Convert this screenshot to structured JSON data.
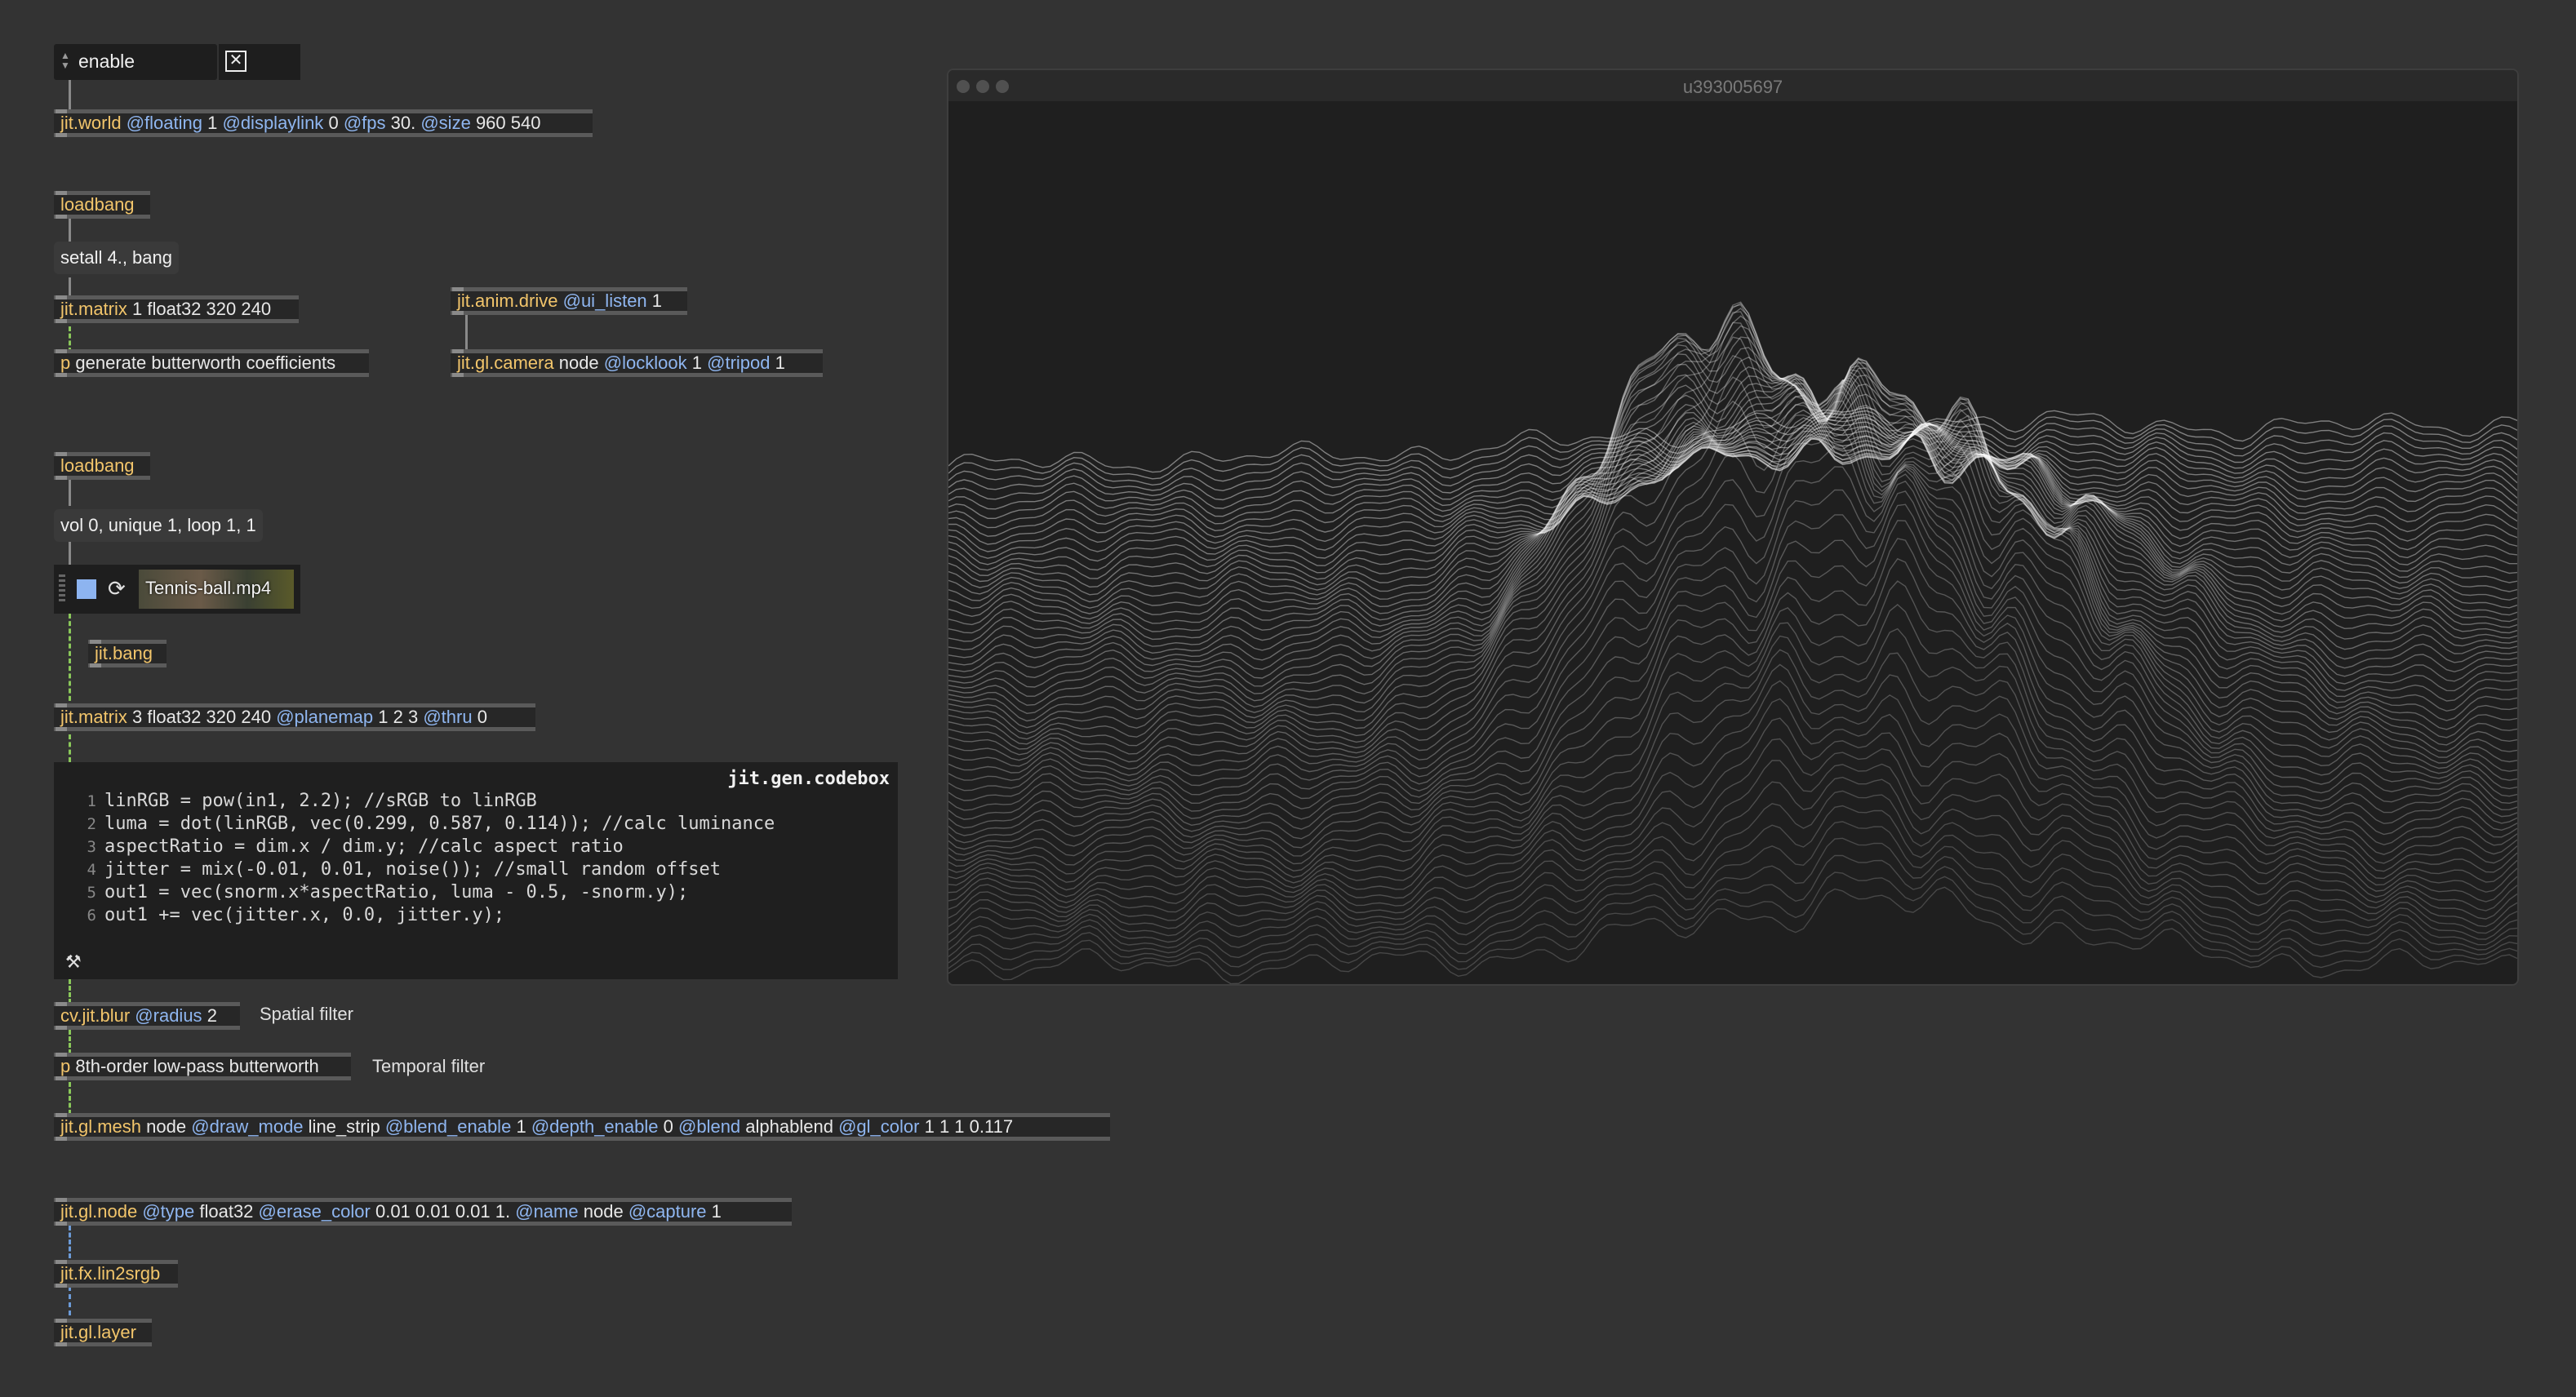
{
  "umenu": {
    "selected": "enable"
  },
  "toggle": {
    "checked": true,
    "glyph": "✕"
  },
  "objects": {
    "jit_world": {
      "cls": "jit.world",
      "parts": [
        [
          "attr",
          "@floating"
        ],
        [
          "arg",
          "1"
        ],
        [
          "attr",
          "@displaylink"
        ],
        [
          "arg",
          "0"
        ],
        [
          "attr",
          "@fps"
        ],
        [
          "arg",
          "30."
        ],
        [
          "attr",
          "@size"
        ],
        [
          "arg",
          "960 540"
        ]
      ]
    },
    "loadbang1": {
      "cls": "loadbang",
      "parts": []
    },
    "jit_matrix1": {
      "cls": "jit.matrix",
      "parts": [
        [
          "arg",
          "1 float32 320 240"
        ]
      ]
    },
    "p_butter_coef": {
      "cls": "p",
      "parts": [
        [
          "arg",
          "generate butterworth coefficients"
        ]
      ]
    },
    "jit_anim_drive": {
      "cls": "jit.anim.drive",
      "parts": [
        [
          "attr",
          "@ui_listen"
        ],
        [
          "arg",
          "1"
        ]
      ]
    },
    "jit_gl_camera": {
      "cls": "jit.gl.camera",
      "parts": [
        [
          "arg",
          "node"
        ],
        [
          "attr",
          "@locklook"
        ],
        [
          "arg",
          "1"
        ],
        [
          "attr",
          "@tripod"
        ],
        [
          "arg",
          "1"
        ]
      ]
    },
    "loadbang2": {
      "cls": "loadbang",
      "parts": []
    },
    "jit_bang": {
      "cls": "jit.bang",
      "parts": []
    },
    "jit_matrix3": {
      "cls": "jit.matrix",
      "parts": [
        [
          "arg",
          "3 float32 320 240"
        ],
        [
          "attr",
          "@planemap"
        ],
        [
          "arg",
          "1 2 3"
        ],
        [
          "attr",
          "@thru"
        ],
        [
          "arg",
          "0"
        ]
      ]
    },
    "cv_jit_blur": {
      "cls": "cv.jit.blur",
      "parts": [
        [
          "attr",
          "@radius"
        ],
        [
          "arg",
          "2"
        ]
      ]
    },
    "p_lowpass": {
      "cls": "p",
      "parts": [
        [
          "arg",
          "8th-order low-pass butterworth"
        ]
      ]
    },
    "jit_gl_mesh": {
      "cls": "jit.gl.mesh",
      "parts": [
        [
          "arg",
          "node"
        ],
        [
          "attr",
          "@draw_mode"
        ],
        [
          "arg",
          "line_strip"
        ],
        [
          "attr",
          "@blend_enable"
        ],
        [
          "arg",
          "1"
        ],
        [
          "attr",
          "@depth_enable"
        ],
        [
          "arg",
          "0"
        ],
        [
          "attr",
          "@blend"
        ],
        [
          "arg",
          "alphablend"
        ],
        [
          "attr",
          "@gl_color"
        ],
        [
          "arg",
          "1 1 1 0.117"
        ]
      ]
    },
    "jit_gl_node": {
      "cls": "jit.gl.node",
      "parts": [
        [
          "attr",
          "@type"
        ],
        [
          "arg",
          "float32"
        ],
        [
          "attr",
          "@erase_color"
        ],
        [
          "arg",
          "0.01 0.01 0.01 1."
        ],
        [
          "attr",
          "@name"
        ],
        [
          "arg",
          "node"
        ],
        [
          "attr",
          "@capture"
        ],
        [
          "arg",
          "1"
        ]
      ]
    },
    "jit_fx_lin2srgb": {
      "cls": "jit.fx.lin2srgb",
      "parts": []
    },
    "jit_gl_layer": {
      "cls": "jit.gl.layer",
      "parts": []
    }
  },
  "messages": {
    "setall": "setall 4., bang",
    "vol": "vol 0, unique 1, loop 1, 1"
  },
  "comments": {
    "spatial": "Spatial filter",
    "temporal": "Temporal filter"
  },
  "playlist": {
    "file": "Tennis-ball.mp4"
  },
  "codebox": {
    "title": "jit.gen.codebox",
    "lines": [
      "linRGB = pow(in1, 2.2); //sRGB to linRGB",
      "luma = dot(linRGB, vec(0.299, 0.587, 0.114)); //calc luminance",
      "aspectRatio = dim.x / dim.y; //calc aspect ratio",
      "jitter = mix(-0.01, 0.01, noise()); //small random offset",
      "out1 = vec(snorm.x*aspectRatio, luma - 0.5, -snorm.y);",
      "out1 += vec(jitter.x, 0.0, jitter.y);"
    ]
  },
  "window": {
    "title": "u393005697"
  },
  "colors": {
    "class": "#f2c56b",
    "attribute": "#8fb6f0",
    "signal_cord": "#8ac85a",
    "background": "#333333"
  }
}
